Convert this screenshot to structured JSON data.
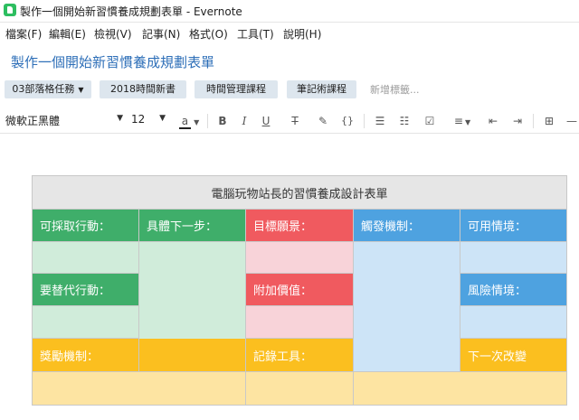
{
  "window": {
    "title": "製作一個開始新習慣養成規劃表單 - Evernote"
  },
  "menu": [
    "檔案(F)",
    "編輯(E)",
    "檢視(V)",
    "記事(N)",
    "格式(O)",
    "工具(T)",
    "說明(H)"
  ],
  "note": {
    "title": "製作一個開始新習慣養成規劃表單",
    "notebook": "03部落格任務",
    "tags": [
      "2018時間新書",
      "時間管理課程",
      "筆記術課程"
    ],
    "tag_placeholder": "新增標籤..."
  },
  "format": {
    "font": "微軟正黑體",
    "size": "12"
  },
  "table": {
    "header": "電腦玩物站長的習慣養成設計表單",
    "row1": [
      "可採取行動：",
      "具體下一步：",
      "目標願景：",
      "觸發機制：",
      "可用情境："
    ],
    "row3": {
      "alt": "要替代行動：",
      "value": "附加價值：",
      "risk": "風險情境："
    },
    "row5": {
      "reward": "獎勵機制：",
      "tools": "記錄工具：",
      "next": "下一次改變"
    }
  },
  "colors": {
    "green": "#3fae6a",
    "red": "#f05a5f",
    "blue": "#4ea2e0",
    "yellow": "#fbbf1f",
    "title_blue": "#2e6fb8"
  }
}
